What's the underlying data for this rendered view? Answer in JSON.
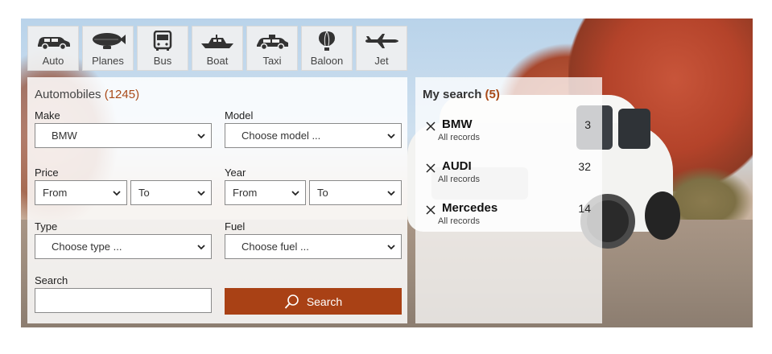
{
  "tabs": [
    {
      "label": "Auto",
      "icon": "car-icon"
    },
    {
      "label": "Planes",
      "icon": "blimp-icon"
    },
    {
      "label": "Bus",
      "icon": "bus-icon"
    },
    {
      "label": "Boat",
      "icon": "boat-icon"
    },
    {
      "label": "Taxi",
      "icon": "taxi-icon"
    },
    {
      "label": "Baloon",
      "icon": "balloon-icon"
    },
    {
      "label": "Jet",
      "icon": "jet-icon"
    }
  ],
  "form": {
    "title": "Automobiles",
    "count": "(1245)",
    "make_label": "Make",
    "make_value": "BMW",
    "model_label": "Model",
    "model_value": "Choose model ...",
    "price_label": "Price",
    "price_from": "From",
    "price_to": "To",
    "year_label": "Year",
    "year_from": "From",
    "year_to": "To",
    "type_label": "Type",
    "type_value": "Choose type ...",
    "fuel_label": "Fuel",
    "fuel_value": "Choose fuel ...",
    "search_label": "Search",
    "search_value": "",
    "search_button": "Search"
  },
  "my_search": {
    "title": "My search",
    "count": "(5)",
    "items": [
      {
        "name": "BMW",
        "sub": "All records",
        "count": "3"
      },
      {
        "name": "AUDI",
        "sub": "All records",
        "count": "32"
      },
      {
        "name": "Mercedes",
        "sub": "All records",
        "count": "14"
      }
    ]
  },
  "colors": {
    "accent": "#a94115",
    "count": "#a94a18"
  }
}
